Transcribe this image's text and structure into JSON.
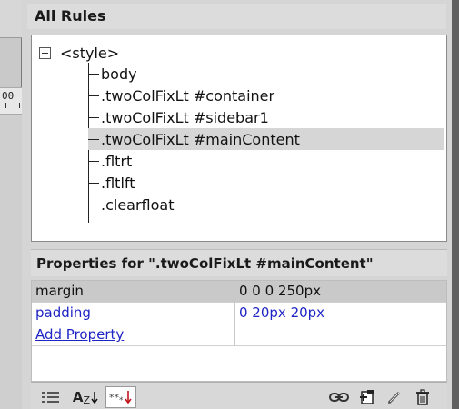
{
  "left_strip": {
    "ruler_text": "00"
  },
  "panel": {
    "title": "All Rules",
    "tree": {
      "root_label": "<style>",
      "items": [
        {
          "label": "body",
          "selected": false
        },
        {
          "label": ".twoColFixLt #container",
          "selected": false
        },
        {
          "label": ".twoColFixLt #sidebar1",
          "selected": false
        },
        {
          "label": ".twoColFixLt #mainContent",
          "selected": true
        },
        {
          "label": ".fltrt",
          "selected": false
        },
        {
          "label": ".fltlft",
          "selected": false
        },
        {
          "label": ".clearfloat",
          "selected": false
        }
      ]
    },
    "properties": {
      "title": "Properties for \".twoColFixLt #mainContent\"",
      "rows": [
        {
          "name": "margin",
          "value": "0 0 0 250px"
        },
        {
          "name": "padding",
          "value": "0 20px 20px"
        }
      ],
      "add_property_label": "Add Property"
    },
    "toolbar": {
      "buttons": [
        {
          "icon": "category-view-icon"
        },
        {
          "icon": "alphabetical-view-icon",
          "text": "A",
          "sub": "Z"
        },
        {
          "icon": "set-properties-view-icon"
        },
        {
          "icon": "attach-stylesheet-icon"
        },
        {
          "icon": "new-css-rule-icon"
        },
        {
          "icon": "edit-style-icon"
        },
        {
          "icon": "delete-css-rule-icon"
        }
      ]
    }
  },
  "colors": {
    "selection_gray": "#d6d6d6",
    "link_blue": "#1f25c4",
    "accent_red": "#c2141b"
  }
}
